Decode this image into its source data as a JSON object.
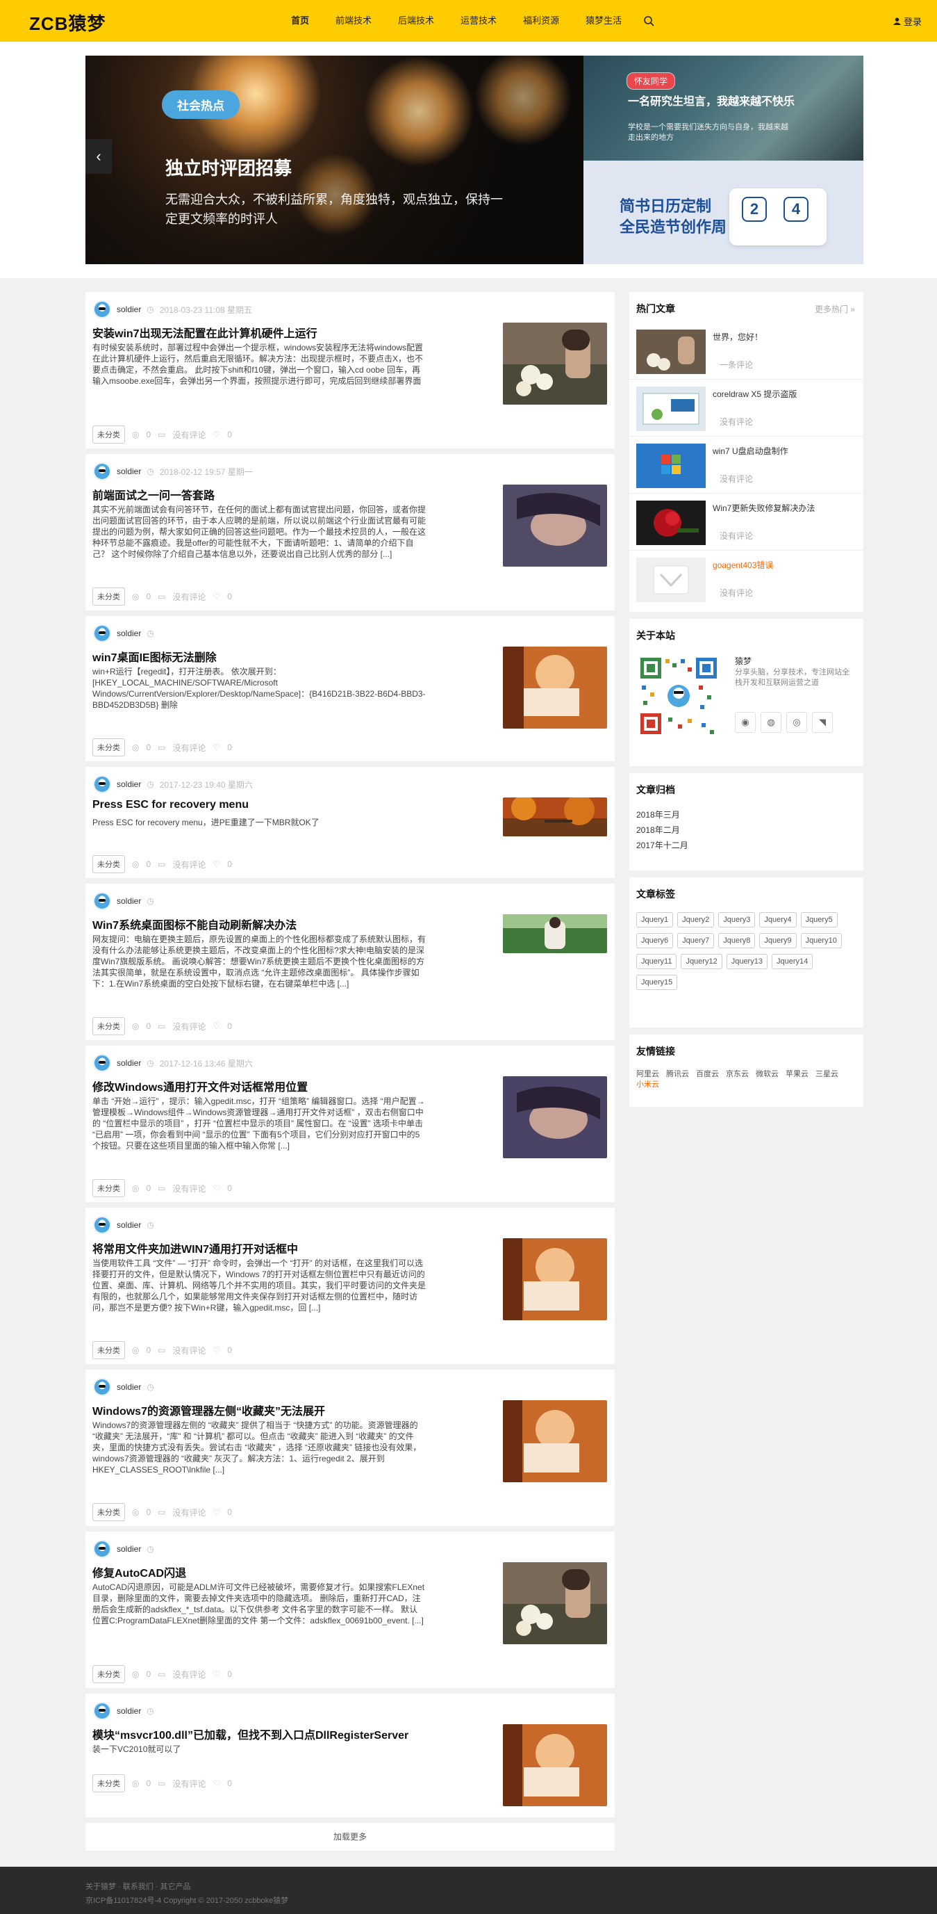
{
  "header": {
    "logo": "ZCB猿梦",
    "nav": [
      "首页",
      "前端技术",
      "后端技术",
      "运营技术",
      "福利资源",
      "猿梦生活"
    ],
    "login": "登录"
  },
  "hero": {
    "tag": "社会热点",
    "title": "独立时评团招募",
    "desc": "无需迎合大众，不被利益所累，角度独特，观点独立，保持一定更文频率的时评人",
    "side1": {
      "tag": "怀友同学",
      "title": "一名研究生坦言，我越来越不快乐",
      "desc": "学校是一个需要我们迷失方向与自身，我越来越走出来的地方"
    },
    "side2": {
      "line1": "简书日历定制",
      "line2": "全民造节创作周",
      "cal_a": "2",
      "cal_b": "4"
    }
  },
  "posts": [
    {
      "author": "soldier",
      "date": "2018-03-23 11:08 星期五",
      "title": "安装win7出现无法配置在此计算机硬件上运行",
      "excerpt": "有时候安装系统时，部署过程中会弹出一个提示框，windows安装程序无法将windows配置在此计算机硬件上运行，然后重启无限循环。解决方法：出现提示框时，不要点击X，也不要点击确定，不然会重启。 此时按下shift和f10键，弹出一个窗口，输入cd oobe 回车，再输入msoobe.exe回车，会弹出另一个界面，按照提示进行即可，完成后回到继续部署界面并点确定，系统重启，之后一切正常。。",
      "category": "未分类",
      "views": "0",
      "comments": "没有评论",
      "likes": "0"
    },
    {
      "author": "soldier",
      "date": "2018-02-12 19:57 星期一",
      "title": "前端面试之一问一答套路",
      "excerpt": "其实不光前端面试会有问答环节，在任何的面试上都有面试官提出问题，你回答，或者你提出问题面试官回答的环节，由于本人应聘的是前端，所以说以前端这个行业面试官最有可能提出的问题为例，帮大家如何正确的回答这些问题吧。作为一个最技术控员的人，一般在这种环节总能不露痕迹。我是offer的可能性就不大，下面请听题吧：1、请简单的介绍下自己？ 这个时候你除了介绍自己基本信息以外，还要说出自己比别人优秀的部分 [...]",
      "category": "未分类",
      "views": "0",
      "comments": "没有评论",
      "likes": "0"
    },
    {
      "author": "soldier",
      "date": "",
      "title": "win7桌面IE图标无法删除",
      "excerpt": "win+R运行【regedit】，打开注册表。 依次展开到：[HKEY_LOCAL_MACHINE/SOFTWARE/Microsoft Windows/CurrentVersion/Explorer/Desktop/NameSpace]：{B416D21B-3B22-B6D4-BBD3-BBD452DB3D5B} 删除",
      "category": "未分类",
      "views": "0",
      "comments": "没有评论",
      "likes": "0"
    },
    {
      "author": "soldier",
      "date": "2017-12-23 19:40 星期六",
      "title": "Press ESC for recovery menu",
      "excerpt": "Press ESC for recovery menu，进PE重建了一下MBR就OK了",
      "category": "未分类",
      "views": "0",
      "comments": "没有评论",
      "likes": "0"
    },
    {
      "author": "soldier",
      "date": "",
      "title": "Win7系统桌面图标不能自动刷新解决办法",
      "excerpt": "网友提问：电脑在更换主题后，原先设置的桌面上的个性化图标都变成了系统默认图标，有没有什么办法能够让系统更换主题后，不改变桌面上的个性化图标?求大神!电脑安装的是深度Win7旗舰版系统。 画说唤心解答：想要Win7系统更换主题后不更换个性化桌面图标的方法其实很简单，就是在系统设置中，取消点选 “允许主题修改桌面图标”。 具体操作步骤如下：1.在Win7系统桌面的空白处按下鼠标右键，在右键菜单栏中选 [...]",
      "category": "未分类",
      "views": "0",
      "comments": "没有评论",
      "likes": "0"
    },
    {
      "author": "soldier",
      "date": "2017-12-16 13:46 星期六",
      "title": "修改Windows通用打开文件对话框常用位置",
      "excerpt": "单击 “开始→运行” ，提示：输入gpedit.msc，打开 “组策略” 编辑器窗口。选择 “用户配置→管理模板→Windows组件→Windows资源管理器→通用打开文件对话框” ，双击右侧窗口中的 “位置栏中显示的项目” ，打开 “位置栏中显示的项目” 属性窗口。在 “设置” 选项卡中单击 “已启用” 一项，你会看到中间 “显示的位置” 下面有5个项目，它们分别对应打开窗口中的5个按钮。只要在这些项目里面的输入框中输入你常 [...]",
      "category": "未分类",
      "views": "0",
      "comments": "没有评论",
      "likes": "0"
    },
    {
      "author": "soldier",
      "date": "",
      "title": "将常用文件夹加进WIN7通用打开对话框中",
      "excerpt": "当使用软件工具 “文件” — “打开” 命令时，会弹出一个 “打开” 的对话框，在这里我们可以选择要打开的文件，但是默认情况下，Windows 7的打开对话框左侧位置栏中只有最近访问的位置、桌面、库、计算机、网络等几个并不实用的项目。其实，我们平时要访问的文件夹是有限的，也就那么几个，如果能够常用文件夹保存到打开对话框左侧的位置栏中，随时访问，那岂不是更方便? 按下Win+R键，输入gpedit.msc，回 [...]",
      "category": "未分类",
      "views": "0",
      "comments": "没有评论",
      "likes": "0"
    },
    {
      "author": "soldier",
      "date": "",
      "title": "Windows7的资源管理器左侧“收藏夹”无法展开",
      "excerpt": "Windows7的资源管理器左侧的 “收藏夹” 提供了相当于 “快捷方式” 的功能。资源管理器的 “收藏夹” 无法展开，“库” 和 “计算机” 都可以。但点击 “收藏夹” 能进入到 “收藏夹” 的文件夹，里面的快捷方式没有丢失。尝试右击 “收藏夹” ，选择 “还原收藏夹” 链接也没有效果，windows7资源管理器的 “收藏夹” 灰灭了。解决方法：1、运行regedit 2、展开到HKEY_CLASSES_ROOT\\lnkfile [...]",
      "category": "未分类",
      "views": "0",
      "comments": "没有评论",
      "likes": "0"
    },
    {
      "author": "soldier",
      "date": "",
      "title": "修复AutoCAD闪退",
      "excerpt": "AutoCAD闪退原因，可能是ADLM许可文件已经被破坏，需要修复才行。如果搜索FLEXnet目录，删除里面的文件，需要去掉文件夹选项中的隐藏选项。 删除后，重新打开CAD，注册后会生成新的adskflex_*_tsf.data。以下仅供参考 文件名字里的数字可能不一样。 默认位置C:ProgramDataFLEXnet删除里面的文件 第一个文件：adskflex_00691b00_event. [...]",
      "category": "未分类",
      "views": "0",
      "comments": "没有评论",
      "likes": "0"
    },
    {
      "author": "soldier",
      "date": "",
      "title": "模块“msvcr100.dll”已加载，但找不到入口点DllRegisterServer",
      "excerpt": "装一下VC2010就可以了",
      "category": "未分类",
      "views": "0",
      "comments": "没有评论",
      "likes": "0"
    }
  ],
  "load_more": "加载更多",
  "sidebar": {
    "hot": {
      "title": "热门文章",
      "more": "更多热门 »",
      "items": [
        {
          "title": "世界，您好！",
          "count": "一条评论",
          "color": "#333333"
        },
        {
          "title": "coreldraw X5 提示盗版",
          "count": "没有评论",
          "color": "#333333"
        },
        {
          "title": "win7 U盘启动盘制作",
          "count": "没有评论",
          "color": "#333333"
        },
        {
          "title": "Win7更新失败修复解决办法",
          "count": "没有评论",
          "color": "#333333"
        },
        {
          "title": "goagent403错误",
          "count": "没有评论",
          "color": "#ff6600"
        }
      ]
    },
    "about": {
      "title": "关于本站",
      "name": "猿梦",
      "bio": "分享头脑，分享技术，专注网站全栈开发和互联网运营之道"
    },
    "archive": {
      "title": "文章归档",
      "items": [
        "2018年三月",
        "2018年二月",
        "2017年十二月"
      ]
    },
    "tags": {
      "title": "文章标签",
      "items": [
        "Jquery1",
        "Jquery2",
        "Jquery3",
        "Jquery4",
        "Jquery5",
        "Jquery6",
        "Jquery7",
        "Jquery8",
        "Jquery9",
        "Jquery10",
        "Jquery11",
        "Jquery12",
        "Jquery13",
        "Jquery14",
        "Jquery15"
      ]
    },
    "links": {
      "title": "友情链接",
      "items": [
        "阿里云",
        "腾讯云",
        "百度云",
        "京东云",
        "微软云",
        "苹果云",
        "三星云"
      ],
      "highlight": "小米云"
    }
  },
  "footer": {
    "line1": "关于猿梦 · 联系我们 · 其它产品",
    "line2": "京ICP备11017824号-4 Copyright © 2017-2050 zcbboke猿梦"
  }
}
